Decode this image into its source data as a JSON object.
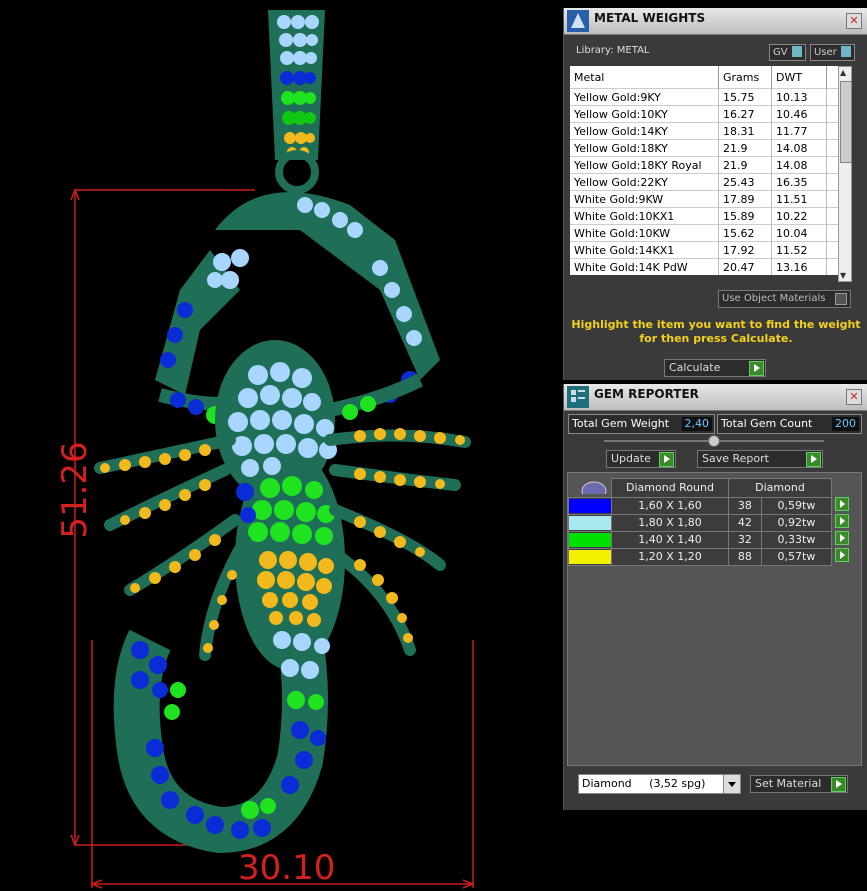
{
  "viewport": {
    "dim_horizontal": "30.10",
    "dim_vertical": "51.26"
  },
  "metal_panel": {
    "title": "METAL WEIGHTS",
    "library": "Library: METAL",
    "gv_label": "GV",
    "user_label": "User",
    "columns": [
      "Metal",
      "Grams",
      "DWT"
    ],
    "rows": [
      [
        "Yellow Gold:9KY",
        "15.75",
        "10.13"
      ],
      [
        "Yellow Gold:10KY",
        "16.27",
        "10.46"
      ],
      [
        "Yellow Gold:14KY",
        "18.31",
        "11.77"
      ],
      [
        "Yellow Gold:18KY",
        "21.9",
        "14.08"
      ],
      [
        "Yellow Gold:18KY Royal",
        "21.9",
        "14.08"
      ],
      [
        "Yellow Gold:22KY",
        "25.43",
        "16.35"
      ],
      [
        "White Gold:9KW",
        "17.89",
        "11.51"
      ],
      [
        "White Gold:10KX1",
        "15.89",
        "10.22"
      ],
      [
        "White Gold:10KW",
        "15.62",
        "10.04"
      ],
      [
        "White Gold:14KX1",
        "17.92",
        "11.52"
      ],
      [
        "White Gold:14K PdW",
        "20.47",
        "13.16"
      ]
    ],
    "use_object_materials": "Use Object Materials",
    "hint_line1": "Highlight the item you want to find the weight",
    "hint_line2": "for then press Calculate.",
    "calculate_label": "Calculate"
  },
  "gem_panel": {
    "title": "GEM REPORTER",
    "total_weight_label": "Total Gem Weight",
    "total_weight_value": "2,40",
    "total_count_label": "Total Gem Count",
    "total_count_value": "200",
    "update_label": "Update",
    "save_report_label": "Save Report",
    "header_shape": "Diamond Round",
    "header_material": "Diamond",
    "rows": [
      {
        "color": "#0000ff",
        "size": "1,60 X 1,60",
        "count": "38",
        "weight": "0,59tw"
      },
      {
        "color": "#a8e8f0",
        "size": "1,80 X 1,80",
        "count": "42",
        "weight": "0,92tw"
      },
      {
        "color": "#00e000",
        "size": "1,40 X 1,40",
        "count": "32",
        "weight": "0,33tw"
      },
      {
        "color": "#f2f000",
        "size": "1,20 X 1,20",
        "count": "88",
        "weight": "0,57tw"
      }
    ],
    "material_dropdown": "Diamond     (3,52 spg)",
    "set_material_label": "Set Material"
  }
}
